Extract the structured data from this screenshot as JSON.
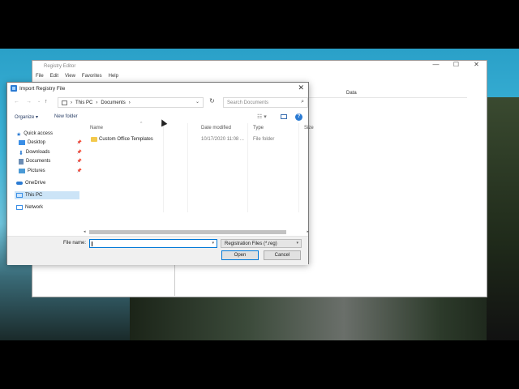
{
  "regedit": {
    "title": "Registry Editor",
    "menu": [
      "File",
      "Edit",
      "View",
      "Favorites",
      "Help"
    ],
    "data_column": "Data",
    "window_controls": {
      "minimize": "—",
      "maximize": "☐",
      "close": "✕"
    }
  },
  "dialog": {
    "title": "Import Registry File",
    "close": "✕",
    "nav_buttons": {
      "back": "←",
      "forward": "→",
      "dropdown": "⌄",
      "up": "↑"
    },
    "breadcrumb": [
      "This PC",
      "Documents"
    ],
    "search_placeholder": "Search Documents",
    "toolbar": {
      "organize": "Organize ▾",
      "new_folder": "New folder",
      "help": "?"
    },
    "nav": [
      {
        "label": "Quick access",
        "icon": "star-icon",
        "color": "#2b7bd3"
      },
      {
        "label": "Desktop",
        "icon": "desktop-icon",
        "color": "#3a8ee6",
        "pinned": true
      },
      {
        "label": "Downloads",
        "icon": "download-icon",
        "color": "#2b7bd3",
        "pinned": true
      },
      {
        "label": "Documents",
        "icon": "document-icon",
        "color": "#6b8db5",
        "pinned": true
      },
      {
        "label": "Pictures",
        "icon": "picture-icon",
        "color": "#4a9ad6",
        "pinned": true
      },
      {
        "label": "OneDrive",
        "icon": "cloud-icon",
        "color": "#2b7bd3"
      },
      {
        "label": "This PC",
        "icon": "computer-icon",
        "color": "#3a8ee6",
        "selected": true
      },
      {
        "label": "Network",
        "icon": "network-icon",
        "color": "#3a8ee6"
      }
    ],
    "columns": [
      "Name",
      "Date modified",
      "Type",
      "Size"
    ],
    "files": [
      {
        "name": "Custom Office Templates",
        "date": "10/17/2020 11:08 ...",
        "type": "File folder",
        "size": ""
      }
    ],
    "file_name_label": "File name:",
    "file_name_value": "",
    "filter": "Registration Files (*.reg)",
    "open": "Open",
    "cancel": "Cancel"
  }
}
